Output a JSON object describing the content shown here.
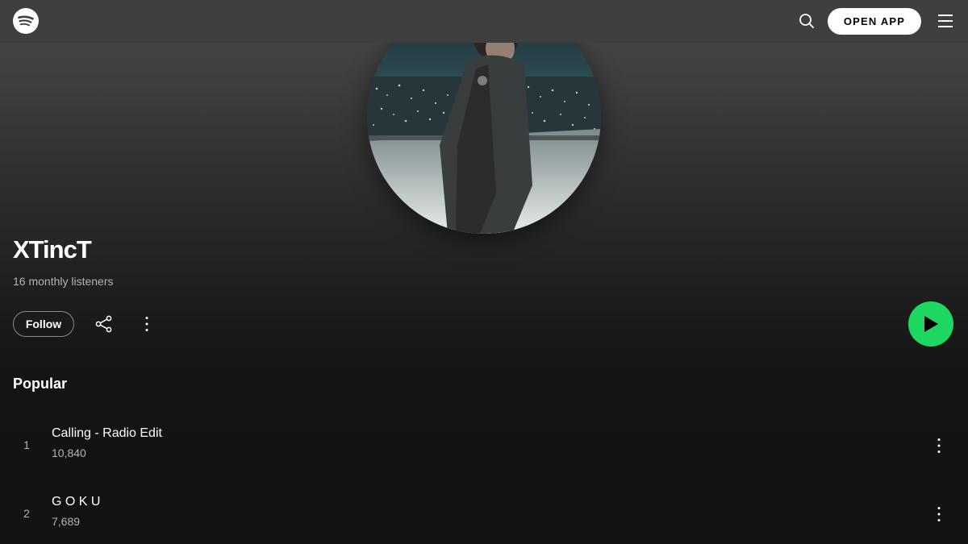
{
  "header": {
    "logo_icon": "spotify-logo-icon",
    "search_icon": "search-icon",
    "open_app_label": "OPEN APP",
    "menu_icon": "hamburger-menu-icon"
  },
  "artist": {
    "name": "XTincT",
    "monthly_listeners": "16 monthly listeners",
    "image_icon": "artist-photo"
  },
  "actions": {
    "follow_label": "Follow",
    "share_icon": "share-icon",
    "more_icon": "more-options-icon",
    "play_icon": "play-icon"
  },
  "popular": {
    "title": "Popular",
    "tracks": [
      {
        "number": "1",
        "title": "Calling - Radio Edit",
        "plays": "10,840"
      },
      {
        "number": "2",
        "title": "G O K U",
        "plays": "7,689"
      }
    ]
  },
  "colors": {
    "accent": "#1ed760",
    "background": "#121212",
    "header": "#3f3f3f",
    "secondary_text": "#b3b3b3"
  }
}
